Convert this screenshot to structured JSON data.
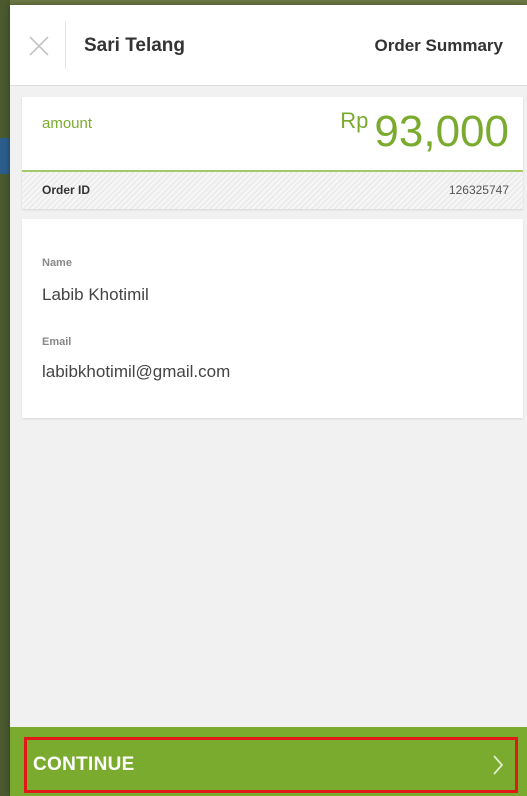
{
  "header": {
    "merchant_name": "Sari Telang",
    "title": "Order Summary",
    "close_icon": "close-icon"
  },
  "amount": {
    "label": "amount",
    "currency": "Rp",
    "value": "93,000"
  },
  "order": {
    "label": "Order ID",
    "value": "126325747"
  },
  "customer": {
    "name_label": "Name",
    "name_value": "Labib Khotimil",
    "email_label": "Email",
    "email_value": "labibkhotimil@gmail.com"
  },
  "footer": {
    "continue_label": "CONTINUE",
    "arrow_icon": "chevron-right-icon"
  },
  "colors": {
    "accent": "#7aab2f",
    "highlight_border": "#e01919"
  }
}
